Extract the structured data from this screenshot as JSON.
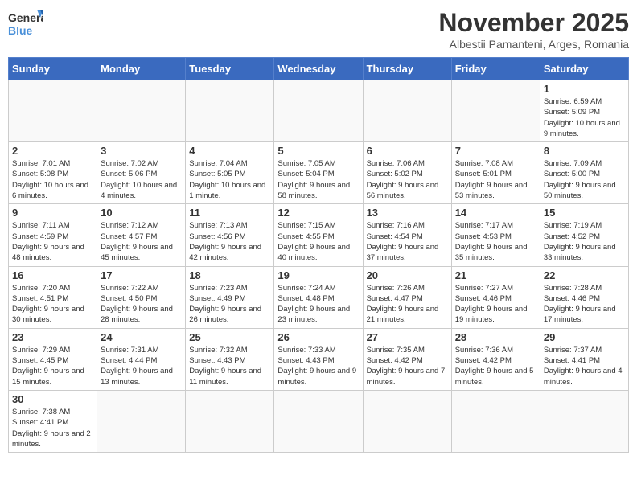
{
  "logo": {
    "text_general": "General",
    "text_blue": "Blue"
  },
  "title": "November 2025",
  "subtitle": "Albestii Pamanteni, Arges, Romania",
  "days_of_week": [
    "Sunday",
    "Monday",
    "Tuesday",
    "Wednesday",
    "Thursday",
    "Friday",
    "Saturday"
  ],
  "weeks": [
    [
      {
        "day": "",
        "info": ""
      },
      {
        "day": "",
        "info": ""
      },
      {
        "day": "",
        "info": ""
      },
      {
        "day": "",
        "info": ""
      },
      {
        "day": "",
        "info": ""
      },
      {
        "day": "",
        "info": ""
      },
      {
        "day": "1",
        "info": "Sunrise: 6:59 AM\nSunset: 5:09 PM\nDaylight: 10 hours and 9 minutes."
      }
    ],
    [
      {
        "day": "2",
        "info": "Sunrise: 7:01 AM\nSunset: 5:08 PM\nDaylight: 10 hours and 6 minutes."
      },
      {
        "day": "3",
        "info": "Sunrise: 7:02 AM\nSunset: 5:06 PM\nDaylight: 10 hours and 4 minutes."
      },
      {
        "day": "4",
        "info": "Sunrise: 7:04 AM\nSunset: 5:05 PM\nDaylight: 10 hours and 1 minute."
      },
      {
        "day": "5",
        "info": "Sunrise: 7:05 AM\nSunset: 5:04 PM\nDaylight: 9 hours and 58 minutes."
      },
      {
        "day": "6",
        "info": "Sunrise: 7:06 AM\nSunset: 5:02 PM\nDaylight: 9 hours and 56 minutes."
      },
      {
        "day": "7",
        "info": "Sunrise: 7:08 AM\nSunset: 5:01 PM\nDaylight: 9 hours and 53 minutes."
      },
      {
        "day": "8",
        "info": "Sunrise: 7:09 AM\nSunset: 5:00 PM\nDaylight: 9 hours and 50 minutes."
      }
    ],
    [
      {
        "day": "9",
        "info": "Sunrise: 7:11 AM\nSunset: 4:59 PM\nDaylight: 9 hours and 48 minutes."
      },
      {
        "day": "10",
        "info": "Sunrise: 7:12 AM\nSunset: 4:57 PM\nDaylight: 9 hours and 45 minutes."
      },
      {
        "day": "11",
        "info": "Sunrise: 7:13 AM\nSunset: 4:56 PM\nDaylight: 9 hours and 42 minutes."
      },
      {
        "day": "12",
        "info": "Sunrise: 7:15 AM\nSunset: 4:55 PM\nDaylight: 9 hours and 40 minutes."
      },
      {
        "day": "13",
        "info": "Sunrise: 7:16 AM\nSunset: 4:54 PM\nDaylight: 9 hours and 37 minutes."
      },
      {
        "day": "14",
        "info": "Sunrise: 7:17 AM\nSunset: 4:53 PM\nDaylight: 9 hours and 35 minutes."
      },
      {
        "day": "15",
        "info": "Sunrise: 7:19 AM\nSunset: 4:52 PM\nDaylight: 9 hours and 33 minutes."
      }
    ],
    [
      {
        "day": "16",
        "info": "Sunrise: 7:20 AM\nSunset: 4:51 PM\nDaylight: 9 hours and 30 minutes."
      },
      {
        "day": "17",
        "info": "Sunrise: 7:22 AM\nSunset: 4:50 PM\nDaylight: 9 hours and 28 minutes."
      },
      {
        "day": "18",
        "info": "Sunrise: 7:23 AM\nSunset: 4:49 PM\nDaylight: 9 hours and 26 minutes."
      },
      {
        "day": "19",
        "info": "Sunrise: 7:24 AM\nSunset: 4:48 PM\nDaylight: 9 hours and 23 minutes."
      },
      {
        "day": "20",
        "info": "Sunrise: 7:26 AM\nSunset: 4:47 PM\nDaylight: 9 hours and 21 minutes."
      },
      {
        "day": "21",
        "info": "Sunrise: 7:27 AM\nSunset: 4:46 PM\nDaylight: 9 hours and 19 minutes."
      },
      {
        "day": "22",
        "info": "Sunrise: 7:28 AM\nSunset: 4:46 PM\nDaylight: 9 hours and 17 minutes."
      }
    ],
    [
      {
        "day": "23",
        "info": "Sunrise: 7:29 AM\nSunset: 4:45 PM\nDaylight: 9 hours and 15 minutes."
      },
      {
        "day": "24",
        "info": "Sunrise: 7:31 AM\nSunset: 4:44 PM\nDaylight: 9 hours and 13 minutes."
      },
      {
        "day": "25",
        "info": "Sunrise: 7:32 AM\nSunset: 4:43 PM\nDaylight: 9 hours and 11 minutes."
      },
      {
        "day": "26",
        "info": "Sunrise: 7:33 AM\nSunset: 4:43 PM\nDaylight: 9 hours and 9 minutes."
      },
      {
        "day": "27",
        "info": "Sunrise: 7:35 AM\nSunset: 4:42 PM\nDaylight: 9 hours and 7 minutes."
      },
      {
        "day": "28",
        "info": "Sunrise: 7:36 AM\nSunset: 4:42 PM\nDaylight: 9 hours and 5 minutes."
      },
      {
        "day": "29",
        "info": "Sunrise: 7:37 AM\nSunset: 4:41 PM\nDaylight: 9 hours and 4 minutes."
      }
    ],
    [
      {
        "day": "30",
        "info": "Sunrise: 7:38 AM\nSunset: 4:41 PM\nDaylight: 9 hours and 2 minutes."
      },
      {
        "day": "",
        "info": ""
      },
      {
        "day": "",
        "info": ""
      },
      {
        "day": "",
        "info": ""
      },
      {
        "day": "",
        "info": ""
      },
      {
        "day": "",
        "info": ""
      },
      {
        "day": "",
        "info": ""
      }
    ]
  ]
}
